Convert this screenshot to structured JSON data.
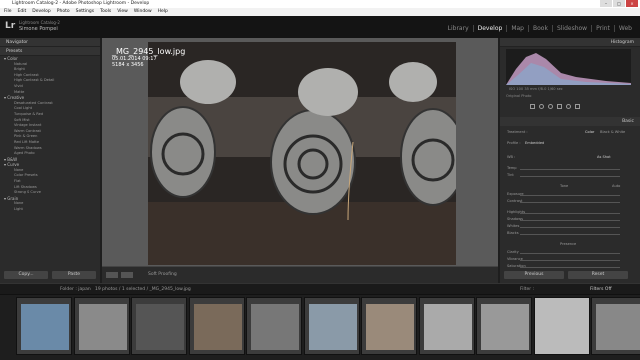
{
  "window": {
    "title": "Lightroom Catalog-2 - Adobe Photoshop Lightroom - Develop"
  },
  "menu": [
    "File",
    "Edit",
    "Develop",
    "Photo",
    "Settings",
    "Tools",
    "View",
    "Window",
    "Help"
  ],
  "identity": {
    "logo": "Lr",
    "catalog": "Lightroom Catalog-2",
    "user": "Simone Pompei"
  },
  "modules": [
    "Library",
    "Develop",
    "Map",
    "Book",
    "Slideshow",
    "Print",
    "Web"
  ],
  "active_module": "Develop",
  "left": {
    "navigator": "Navigator",
    "presets": "Presets",
    "groups": [
      {
        "name": "Color",
        "items": [
          "Natural",
          "Bright",
          "High Contrast",
          "High Contrast & Detail",
          "Vivid",
          "Matte"
        ]
      },
      {
        "name": "Creative",
        "items": [
          "Desaturated Contrast",
          "Cool Light",
          "Turquoise & Red",
          "Soft Mist",
          "Vintage Instant",
          "Warm Contrast",
          "Pink & Green",
          "Red Lift Matte",
          "Warm Shadows",
          "Aged Photo"
        ]
      },
      {
        "name": "B&W",
        "items": []
      },
      {
        "name": "Curve",
        "items": [
          "None",
          "Color Presets",
          "Flat",
          "Lift Shadows",
          "Strong S Curve"
        ]
      },
      {
        "name": "Grain",
        "items": [
          "None",
          "Light"
        ]
      }
    ],
    "copy": "Copy...",
    "paste": "Paste"
  },
  "photo": {
    "filename": "_MG_2945_low.jpg",
    "date": "05.01.2014 09:17",
    "size": "5184 x 3456"
  },
  "toolbar": {
    "soft_proofing": "Soft Proofing"
  },
  "right": {
    "histogram": "Histogram",
    "exif": "ISO 100   35 mm   f/8.0   1/60 sec",
    "original": "Original Photo",
    "basic": "Basic",
    "treatment": "Treatment :",
    "color": "Color",
    "bw": "Black & White",
    "profile": "Profile :",
    "profile_val": "Embedded",
    "wb": "WB :",
    "wb_val": "As Shot",
    "temp": "Temp",
    "tint": "Tint",
    "tone": "Tone",
    "auto": "Auto",
    "exposure": "Exposure",
    "contrast": "Contrast",
    "highlights": "Highlights",
    "shadows": "Shadows",
    "whites": "Whites",
    "blacks": "Blacks",
    "presence": "Presence",
    "clarity": "Clarity",
    "vibrance": "Vibrance",
    "saturation": "Saturation",
    "previous": "Previous",
    "reset": "Reset"
  },
  "filmstrip": {
    "source": "Folder : japan",
    "count": "19 photos / 1 selected / _MG_2945_low.jpg",
    "filter": "Filter :",
    "filter_val": "Filters Off"
  }
}
